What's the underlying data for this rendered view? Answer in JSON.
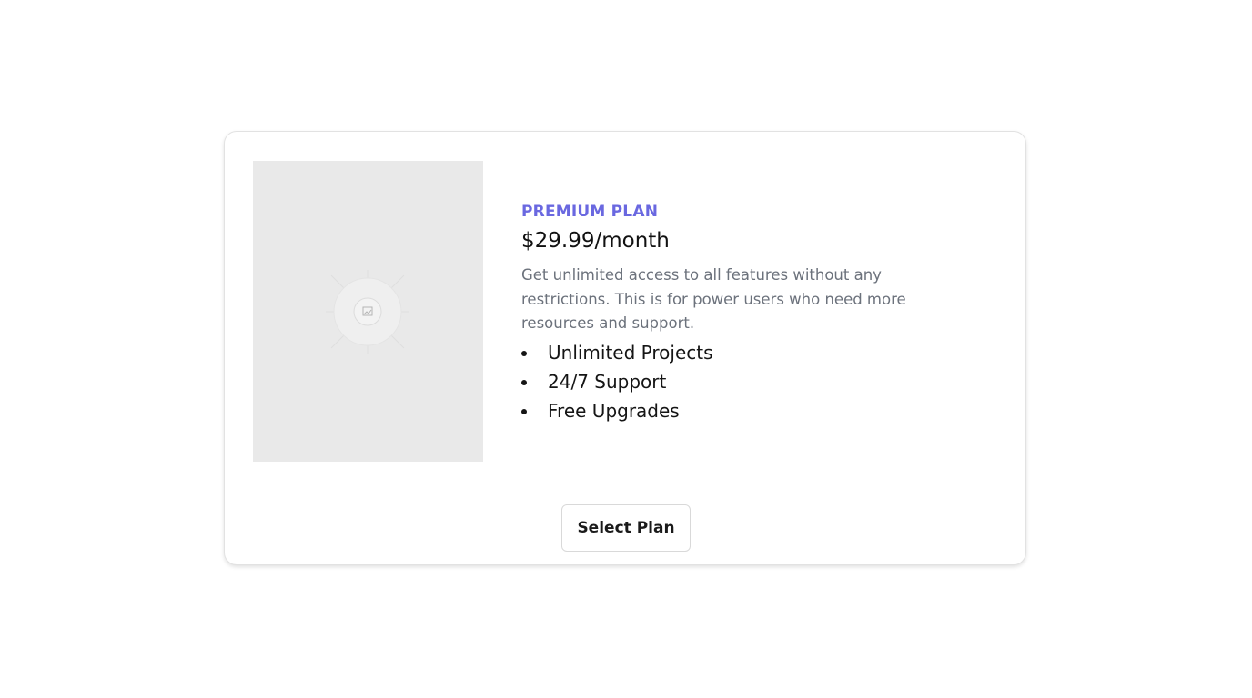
{
  "plan": {
    "name": "PREMIUM PLAN",
    "price": "$29.99/month",
    "description": "Get unlimited access to all features without any restrictions. This is for power users who need more resources and support.",
    "features": [
      "Unlimited Projects",
      "24/7 Support",
      "Free Upgrades"
    ],
    "select_label": "Select Plan",
    "image_icon": "image-placeholder-icon"
  },
  "colors": {
    "accent": "#6a68e0",
    "text": "#111111",
    "muted": "#6c727c",
    "placeholder_bg": "#e9e9e9",
    "border": "#e2e2e2"
  }
}
